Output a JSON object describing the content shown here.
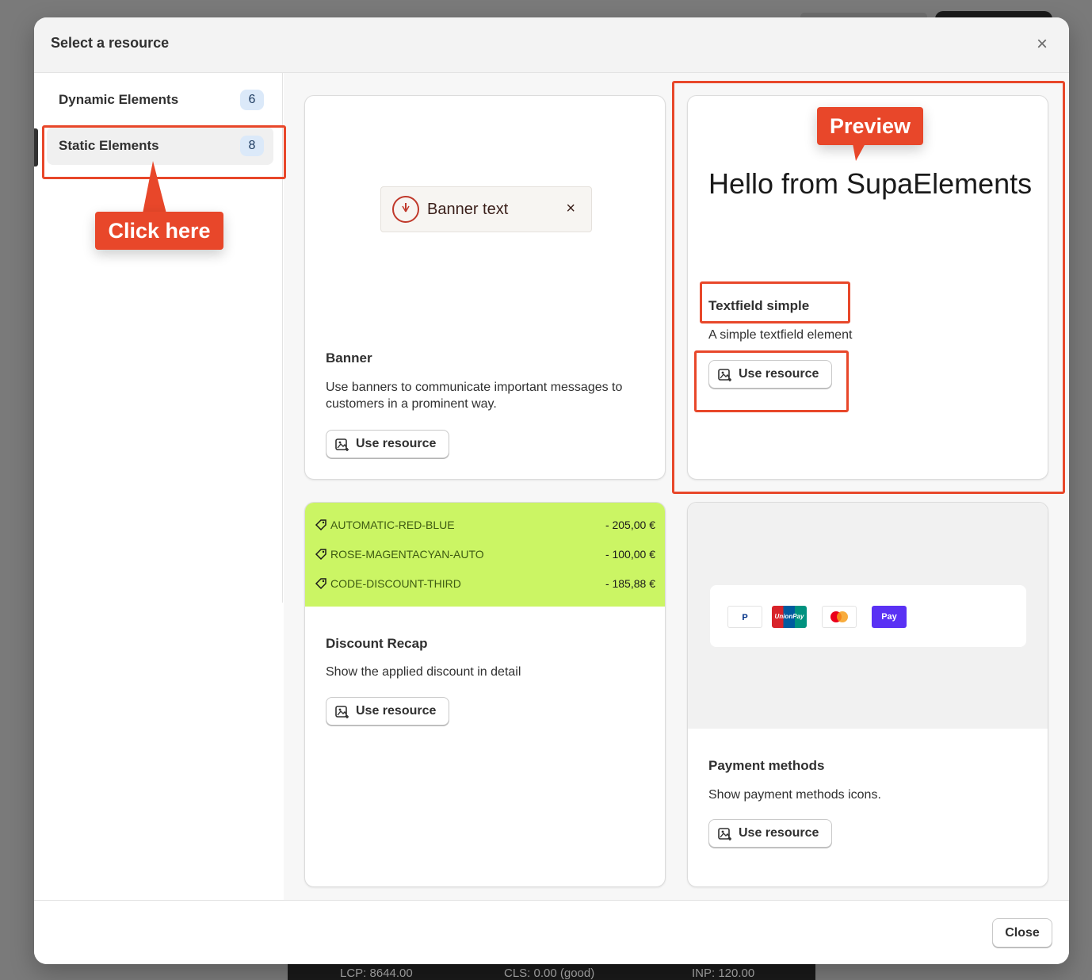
{
  "modal": {
    "title": "Select a resource",
    "close_icon": "×"
  },
  "sidebar": {
    "items": [
      {
        "label": "Dynamic Elements",
        "count": "6"
      },
      {
        "label": "Static Elements",
        "count": "8"
      }
    ]
  },
  "cards": {
    "banner": {
      "preview_text": "Banner text",
      "preview_close": "×",
      "title": "Banner",
      "description": "Use banners to communicate important messages to customers in a prominent way.",
      "button": "Use resource"
    },
    "textfield": {
      "preview_text": "Hello from SupaElements",
      "title": "Textfield simple",
      "description": "A simple textfield element",
      "button": "Use resource"
    },
    "discount": {
      "rows": [
        {
          "code": "AUTOMATIC-RED-BLUE",
          "amount": "- 205,00 €"
        },
        {
          "code": "ROSE-MAGENTACYAN-AUTO",
          "amount": "- 100,00 €"
        },
        {
          "code": "CODE-DISCOUNT-THIRD",
          "amount": "- 185,88 €"
        }
      ],
      "title": "Discount Recap",
      "description": "Show the applied discount in detail",
      "button": "Use resource"
    },
    "payment": {
      "icons": [
        "P",
        "UnionPay",
        "",
        "Pay"
      ],
      "title": "Payment methods",
      "description": "Show payment methods icons.",
      "button": "Use resource"
    }
  },
  "footer": {
    "close_label": "Close"
  },
  "annotations": {
    "click_here": "Click here",
    "preview": "Preview"
  },
  "background": {
    "perf": [
      "LCP: 8644.00",
      "CLS: 0.00 (good)",
      "INP: 120.00"
    ]
  },
  "colors": {
    "accent": "#e8472a",
    "discount_bg": "#cbf564",
    "badge_bg": "#dbe9f9"
  }
}
